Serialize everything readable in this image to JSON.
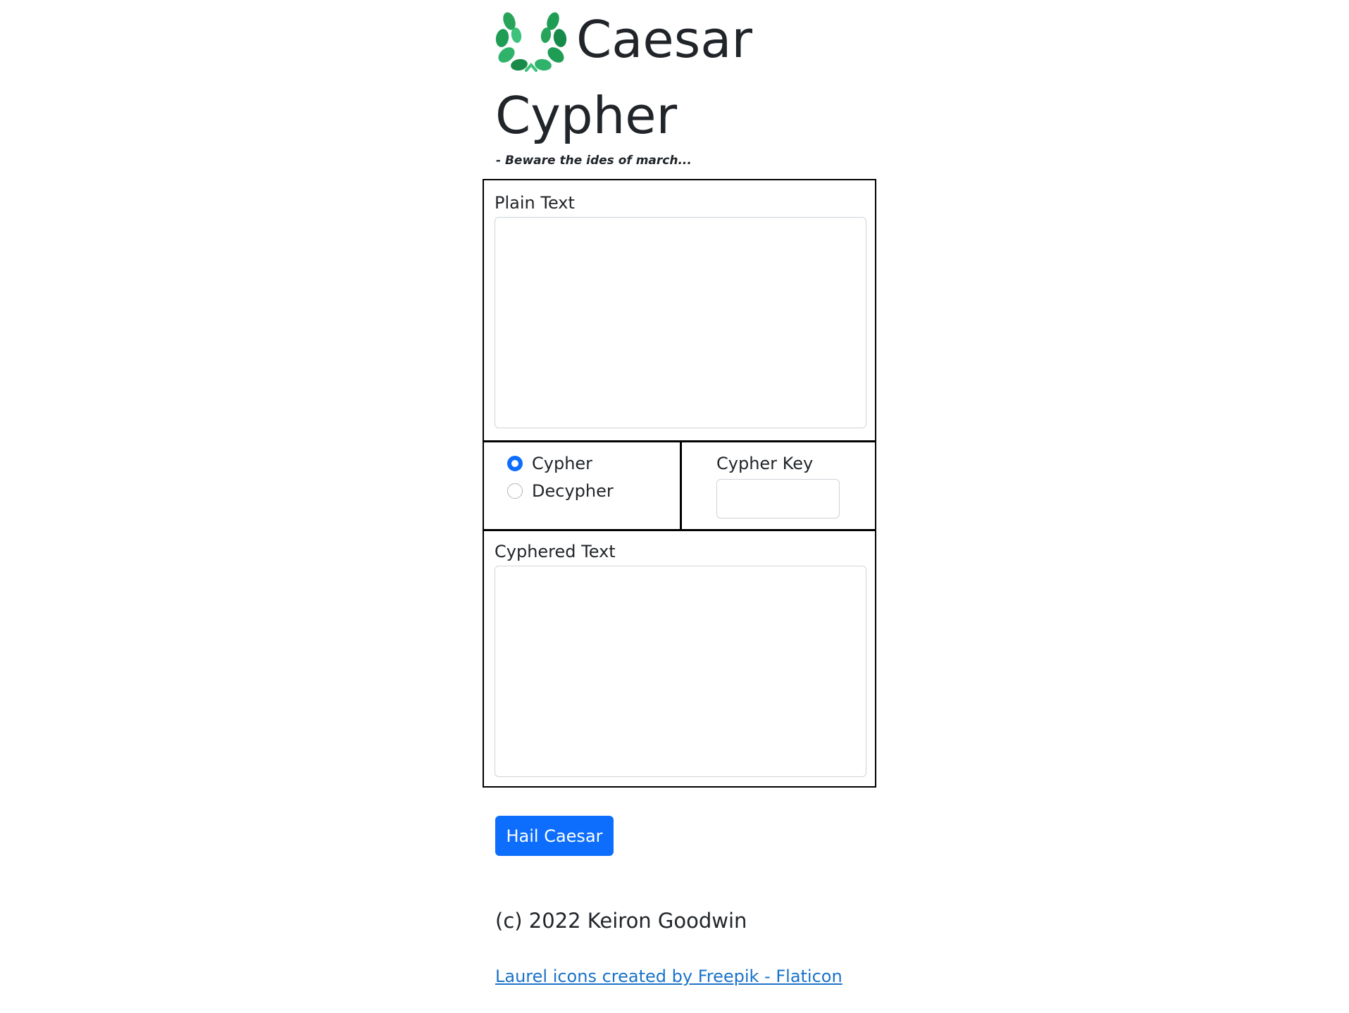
{
  "header": {
    "logo_icon": "laurel-wreath-icon",
    "title_word1": "Caesar",
    "title_word2": "Cypher",
    "tagline": "- Beware the ides of march..."
  },
  "form": {
    "plain_text_label": "Plain Text",
    "plain_text_value": "",
    "mode_options": [
      {
        "label": "Cypher",
        "checked": true
      },
      {
        "label": "Decypher",
        "checked": false
      }
    ],
    "cypher_key_label": "Cypher Key",
    "cypher_key_value": "",
    "cyphered_text_label": "Cyphered Text",
    "cyphered_text_value": ""
  },
  "actions": {
    "submit_label": "Hail Caesar"
  },
  "footer": {
    "copyright": "(c) 2022 Keiron Goodwin",
    "credit_link": "Laurel icons created by Freepik - Flaticon"
  },
  "colors": {
    "primary": "#0d6efd",
    "laurel_green": "#1f9d55",
    "link": "#1a73c8"
  }
}
